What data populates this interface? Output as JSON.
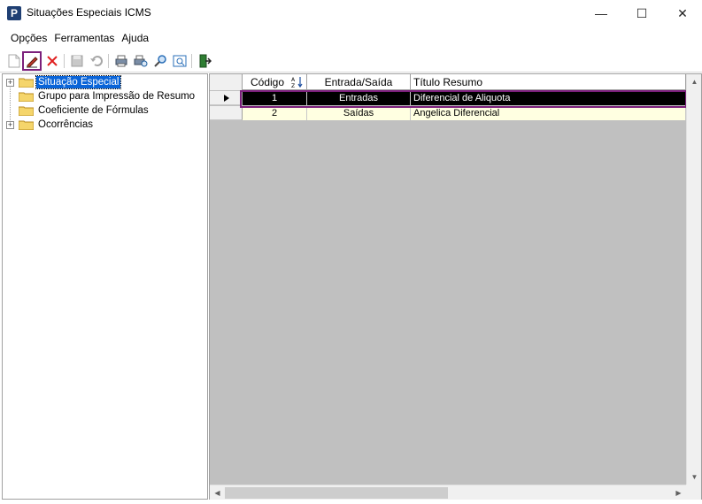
{
  "window": {
    "title": "Situações Especiais ICMS",
    "app_icon_letter": "P",
    "minimize_glyph": "—",
    "maximize_glyph": "☐",
    "close_glyph": "✕"
  },
  "menu": {
    "items": [
      "Opções",
      "Ferramentas",
      "Ajuda"
    ]
  },
  "toolbar": {
    "buttons": [
      {
        "name": "new-icon",
        "enabled": false
      },
      {
        "name": "edit-icon",
        "enabled": true,
        "highlighted": true
      },
      {
        "name": "delete-icon",
        "enabled": true
      },
      {
        "name": "save-icon",
        "enabled": false
      },
      {
        "name": "undo-icon",
        "enabled": false
      },
      {
        "name": "print-icon",
        "enabled": true
      },
      {
        "name": "print-preview-icon",
        "enabled": true
      },
      {
        "name": "search-icon",
        "enabled": true
      },
      {
        "name": "report-icon",
        "enabled": true
      },
      {
        "name": "exit-icon",
        "enabled": true
      }
    ]
  },
  "tree": {
    "items": [
      {
        "label": "Situação Especial",
        "expandable": true,
        "selected": true
      },
      {
        "label": "Grupo para Impressão de Resumo",
        "expandable": false,
        "selected": false
      },
      {
        "label": "Coeficiente de Fórmulas",
        "expandable": false,
        "selected": false
      },
      {
        "label": "Ocorrências",
        "expandable": true,
        "selected": false
      }
    ]
  },
  "grid": {
    "columns": [
      "Código",
      "Entrada/Saída",
      "Título Resumo"
    ],
    "sort_icon": "A-Z sort-descending",
    "rows": [
      {
        "codigo": "1",
        "entrada_saida": "Entradas",
        "titulo_resumo": "Diferencial de Aliquota",
        "selected": true
      },
      {
        "codigo": "2",
        "entrada_saida": "Saídas",
        "titulo_resumo": "Angelica Diferencial",
        "selected": false
      }
    ]
  },
  "colors": {
    "highlight_border": "#7b1f7b",
    "tree_selection": "#0a64d8",
    "alt_row": "#ffffe1",
    "grid_background": "#c0c0c0"
  }
}
